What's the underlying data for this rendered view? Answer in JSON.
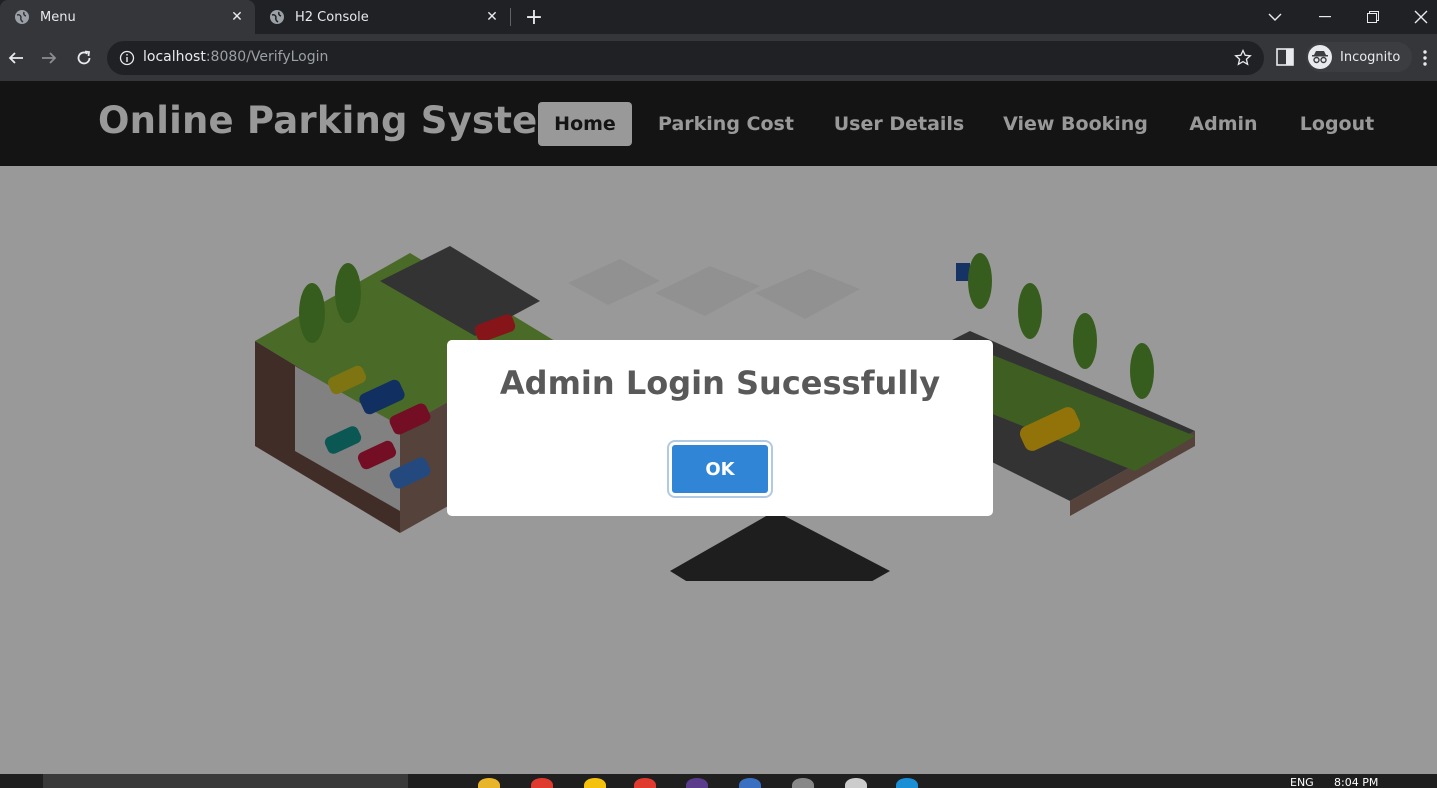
{
  "browser": {
    "tabs": [
      {
        "title": "Menu",
        "active": true
      },
      {
        "title": "H2 Console",
        "active": false
      }
    ],
    "url_host": "localhost",
    "url_path": ":8080/VerifyLogin",
    "profile_label": "Incognito"
  },
  "site": {
    "brand": "Online Parking System",
    "menu": [
      {
        "label": "Home",
        "active": true
      },
      {
        "label": "Parking Cost",
        "active": false
      },
      {
        "label": "User Details",
        "active": false
      },
      {
        "label": "View Booking",
        "active": false
      },
      {
        "label": "Admin",
        "active": false
      },
      {
        "label": "Logout",
        "active": false
      }
    ]
  },
  "dialog": {
    "title": "Admin Login Sucessfully",
    "ok_label": "OK"
  },
  "taskbar": {
    "language": "ENG",
    "time": "8:04 PM"
  },
  "colors": {
    "primary_button": "#3085d6",
    "nav_bg": "#222222"
  }
}
